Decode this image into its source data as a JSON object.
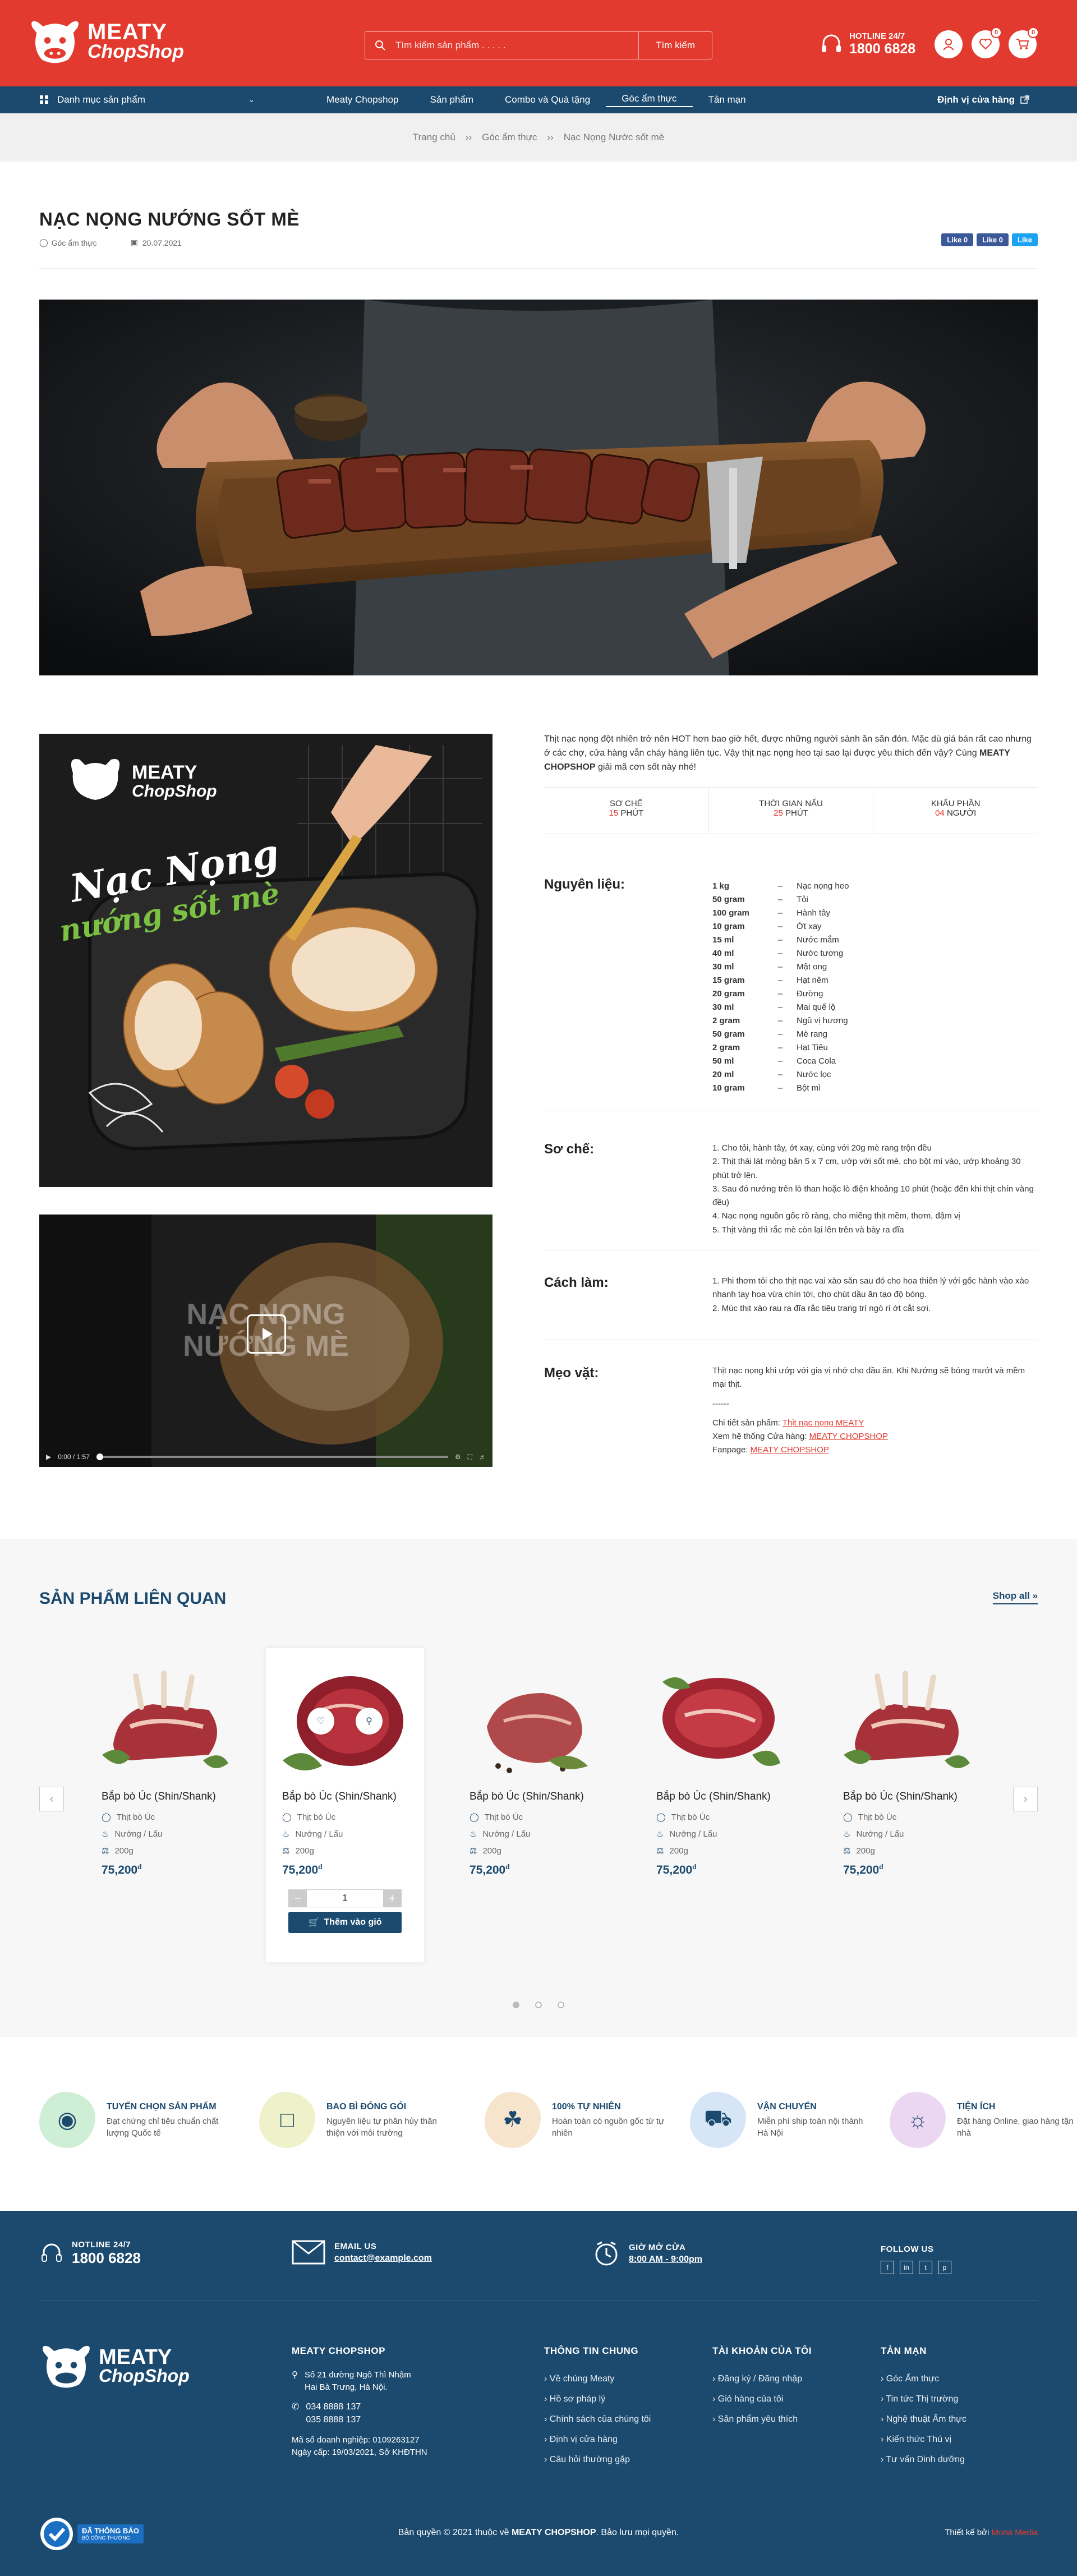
{
  "header": {
    "search_placeholder": "Tìm kiếm sản phẩm . . . . .",
    "search_button": "Tìm kiếm",
    "hotline_label": "HOTLINE 24/7",
    "hotline_number": "1800 6828",
    "wishlist_count": "0",
    "cart_count": "0",
    "logo_line1": "MEATY",
    "logo_line2": "ChopShop"
  },
  "nav": {
    "category_label": "Danh mục sản phẩm",
    "items": [
      "Meaty Chopshop",
      "Sản phẩm",
      "Combo và Quà tặng",
      "Góc ẩm thực",
      "Tản mạn"
    ],
    "store_locator": "Định vị cửa hàng"
  },
  "breadcrumb": [
    "Trang chủ",
    "Góc ẩm thực",
    "Nạc Nọng Nước sốt mè"
  ],
  "article": {
    "title": "NẠC NỌNG NƯỚNG SỐT MÈ",
    "category": "Góc ẩm thực",
    "date": "20.07.2021",
    "share_like_1": "Like 0",
    "share_like_2": "Like 0",
    "share_tweet": "Like",
    "intro_text": "Thịt nạc nọng đột nhiên trở nên HOT hơn bao giờ hết, được những người sành ăn săn đón. Mặc dù giá bán rất cao nhưng ở các chợ, cửa hàng vẫn cháy hàng liên tục. Vậy thịt nạc nọng heo tại sao lại được yêu thích đến vậy? Cùng",
    "intro_bold": "MEATY CHOPSHOP",
    "intro_end": "giải mã cơn sốt này nhé!",
    "poster_line1": "Nạc Nọng",
    "poster_line2": "nướng sốt mè",
    "video_title_line1": "NẠC NỌNG",
    "video_title_line2": "NƯỚNG MÈ",
    "video_time": "0:00 / 1:57",
    "stats": [
      {
        "label": "SƠ CHẾ",
        "value": "15",
        "unit": "PHÚT"
      },
      {
        "label": "THỜI GIAN NẤU",
        "value": "25",
        "unit": "PHÚT"
      },
      {
        "label": "KHẨU PHẦN",
        "value": "04",
        "unit": "NGƯỜI"
      }
    ],
    "ingredients_heading": "Nguyên liệu:",
    "ingredients": [
      {
        "q": "1 kg",
        "n": "Nạc nọng heo"
      },
      {
        "q": "50 gram",
        "n": "Tỏi"
      },
      {
        "q": "100 gram",
        "n": "Hành tây"
      },
      {
        "q": "10 gram",
        "n": "Ớt xay"
      },
      {
        "q": "15 ml",
        "n": "Nước mắm"
      },
      {
        "q": "40 ml",
        "n": "Nước tương"
      },
      {
        "q": "30 ml",
        "n": "Mật ong"
      },
      {
        "q": "15 gram",
        "n": "Hạt nêm"
      },
      {
        "q": "20 gram",
        "n": "Đường"
      },
      {
        "q": "30 ml",
        "n": "Mai quế lộ"
      },
      {
        "q": "2 gram",
        "n": "Ngũ vị hương"
      },
      {
        "q": "50 gram",
        "n": "Mè rang"
      },
      {
        "q": "2 gram",
        "n": "Hạt Tiêu"
      },
      {
        "q": "50 ml",
        "n": "Coca Cola"
      },
      {
        "q": "20 ml",
        "n": "Nước lọc"
      },
      {
        "q": "10 gram",
        "n": "Bột mì"
      }
    ],
    "dash": "–",
    "prep_heading": "Sơ chế:",
    "prep_steps": [
      "1.  Cho tỏi, hành tây, ớt xay, cùng với 20g mè rang trộn đều",
      "2.  Thịt thái lát mỏng bản 5 x 7 cm, ướp với sốt mè, cho bột mì vào, ướp khoảng 30 phút trở lên.",
      "3.  Sau đó nướng trên lò than hoặc lò điện khoảng 10 phút (hoặc đến khi thịt chín vàng đều)",
      "4.  Nạc nọng nguồn gốc rõ ràng, cho miếng thịt mềm, thơm, đậm vị",
      "5.  Thịt vàng thì rắc mè còn lại lên trên và bày ra đĩa"
    ],
    "method_heading": "Cách làm:",
    "method_steps": [
      "1. Phi thơm tỏi cho thịt nạc vai xào săn sau đó cho hoa thiên lý với gốc hành vào xào nhanh tay hoa vừa chín tới, cho chút dầu ăn tạo độ bóng.",
      "2. Múc thịt xào rau ra đĩa rắc tiêu trang trí ngò rí ớt cắt sợi."
    ],
    "tips_heading": "Mẹo vặt:",
    "tips_text": "Thịt nạc nọng khi ướp với gia vị nhớ cho dầu ăn. Khi Nướng sẽ bóng mướt và mềm mại thịt.",
    "tips_sep": "------",
    "tips_detail_label": "Chi tiết sản phẩm:",
    "tips_detail_link": "Thịt nạc nọng MEATY",
    "tips_store_label": "Xem hệ thống Cửa hàng:",
    "tips_store_link": "MEATY CHOPSHOP",
    "tips_fan_label": "Fanpage:",
    "tips_fan_link": "MEATY CHOPSHOP"
  },
  "related": {
    "title": "SẢN PHẨM LIÊN QUAN",
    "shop_all": "Shop all",
    "products": [
      {
        "name": "Bắp bò Úc (Shin/Shank)",
        "type": "Thịt bò Úc",
        "use": "Nướng / Lẩu",
        "weight": "200g",
        "price": "75,200",
        "currency": "đ"
      },
      {
        "name": "Bắp bò Úc (Shin/Shank)",
        "type": "Thịt bò Úc",
        "use": "Nướng / Lẩu",
        "weight": "200g",
        "price": "75,200",
        "currency": "đ"
      },
      {
        "name": "Bắp bò Úc (Shin/Shank)",
        "type": "Thịt bò Úc",
        "use": "Nướng / Lẩu",
        "weight": "200g",
        "price": "75,200",
        "currency": "đ"
      },
      {
        "name": "Bắp bò Úc (Shin/Shank)",
        "type": "Thịt bò Úc",
        "use": "Nướng / Lẩu",
        "weight": "200g",
        "price": "75,200",
        "currency": "đ"
      },
      {
        "name": "Bắp bò Úc (Shin/Shank)",
        "type": "Thịt bò Úc",
        "use": "Nướng / Lẩu",
        "weight": "200g",
        "price": "75,200",
        "currency": "đ"
      }
    ],
    "qty_value": "1",
    "add_to_cart": "Thêm vào giỏ"
  },
  "features": [
    {
      "title": "TUYỂN CHỌN SẢN PHẨM",
      "desc": "Đạt chứng chỉ tiêu chuẩn chất lượng Quốc tế",
      "color": "#cfeed6"
    },
    {
      "title": "BAO BÌ ĐÓNG GÓI",
      "desc": "Nguyên liệu tự phân hủy thân thiện với môi trường",
      "color": "#eef1c9"
    },
    {
      "title": "100% TỰ NHIÊN",
      "desc": "Hoàn toàn có nguồn gốc từ tự nhiên",
      "color": "#f7e4cd"
    },
    {
      "title": "VẬN CHUYỂN",
      "desc": "Miễn phí ship toàn nội thành Hà Nội",
      "color": "#d6e6f7"
    },
    {
      "title": "TIỆN ÍCH",
      "desc": "Đặt hàng Online, giao hàng tận nhà",
      "color": "#ecd7f3"
    }
  ],
  "footer": {
    "hotline_label": "NOTLINE 24/7",
    "hotline_number": "1800 6828",
    "email_label": "EMAIL US",
    "email_value": "contact@example.com",
    "hours_label": "GIỜ MỞ CỬA",
    "hours_value": "8:00 AM - 9:00pm",
    "follow_label": "FOLLOW US",
    "company_heading": "MEATY CHOPSHOP",
    "address": "Số 21 đường Ngô Thì Nhậm Hai Bà Trưng, Hà Nội.",
    "phone1": "034 8888 137",
    "phone2": "035 8888 137",
    "tax_line1": "Mã số doanh nghiệp: 0109263127",
    "tax_line2": "Ngày cấp: 19/03/2021, Sở KHĐTHN",
    "info_heading": "THÔNG TIN CHUNG",
    "info_links": [
      "Về chúng Meaty",
      "Hồ sơ pháp lý",
      "Chính sách của chúng tôi",
      "Định vị cửa hàng",
      "Câu hỏi thường gặp"
    ],
    "account_heading": "TÀI KHOẢN CỦA TÔI",
    "account_links": [
      "Đăng ký / Đăng nhập",
      "Giỏ hàng của tôi",
      "Sản phẩm yêu thích"
    ],
    "blog_heading": "TẢN MẠN",
    "blog_links": [
      "Góc Ẩm thực",
      "Tin tức Thị trường",
      "Nghệ thuật Ẩm thực",
      "Kiến thức Thú vị",
      "Tư vấn Dinh dưỡng"
    ],
    "verified_line1": "ĐÃ THÔNG BÁO",
    "verified_line2": "BỘ CÔNG THƯƠNG",
    "copyright_pre": "Bản quyền © 2021 thuộc về",
    "copyright_brand": "MEATY CHOPSHOP",
    "copyright_post": ". Bảo lưu mọi quyền.",
    "design_label": "Thiết kế bởi",
    "design_by": "Mona Media"
  },
  "colors": {
    "brand_red": "#e23a2e",
    "navy": "#1c4a6e"
  }
}
